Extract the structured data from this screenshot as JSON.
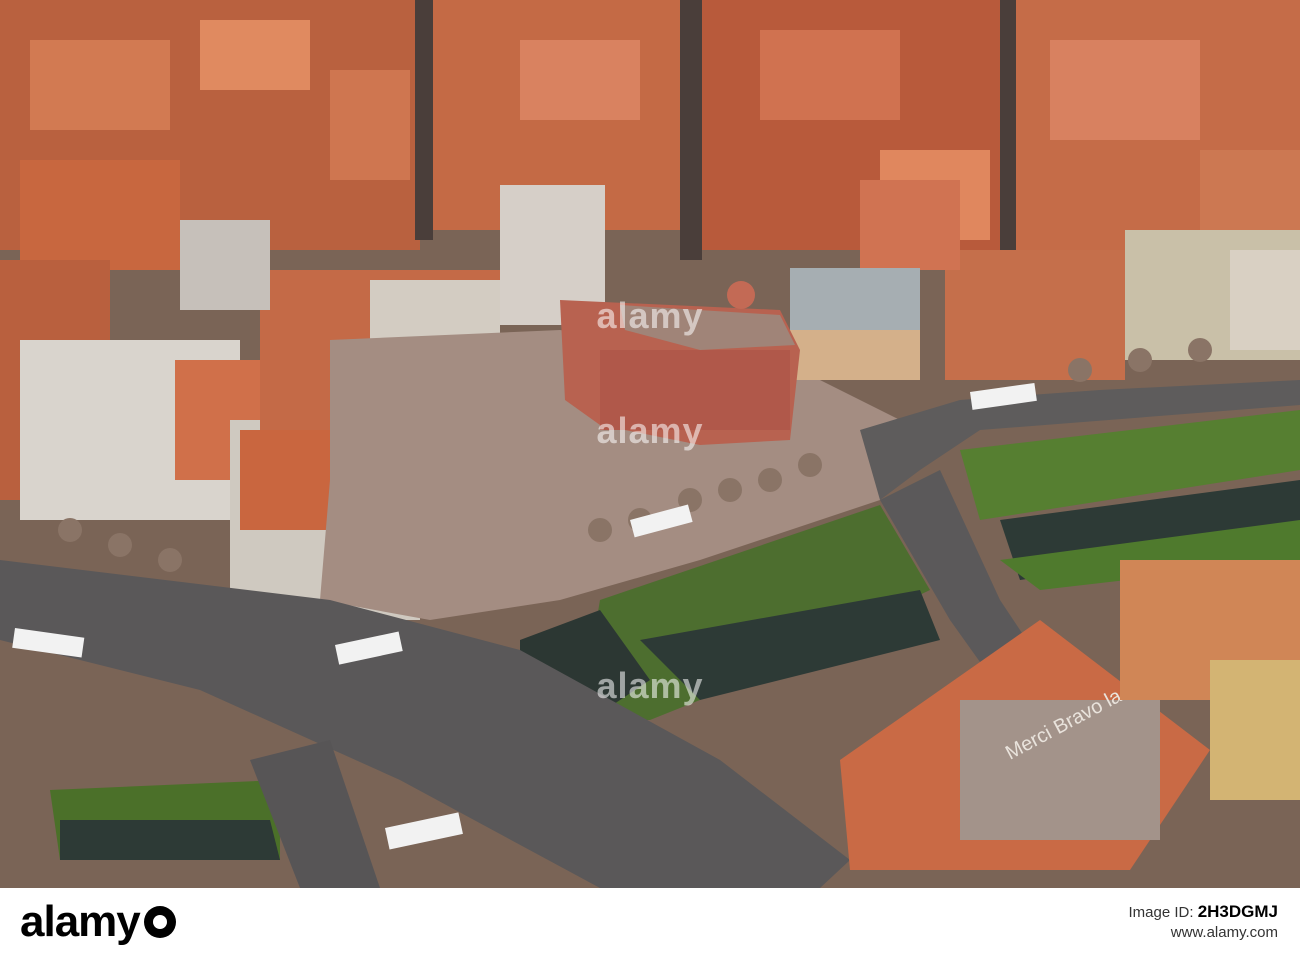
{
  "photo": {
    "subject": "Aerial view of city square with fortified gate"
  },
  "watermark": {
    "text": "alamy"
  },
  "footer": {
    "logo_text": "alamy",
    "image_id_label": "Image ID:",
    "image_id": "2H3DGMJ",
    "url": "www.alamy.com"
  },
  "signage": {
    "rooftop_text": "Merci Bravo la France!"
  },
  "colors": {
    "roof_terracotta": "#c8623f",
    "plaza": "#a18b80",
    "grass": "#4f7a2d",
    "water": "#2d3a36",
    "road": "#5c5a5b"
  }
}
